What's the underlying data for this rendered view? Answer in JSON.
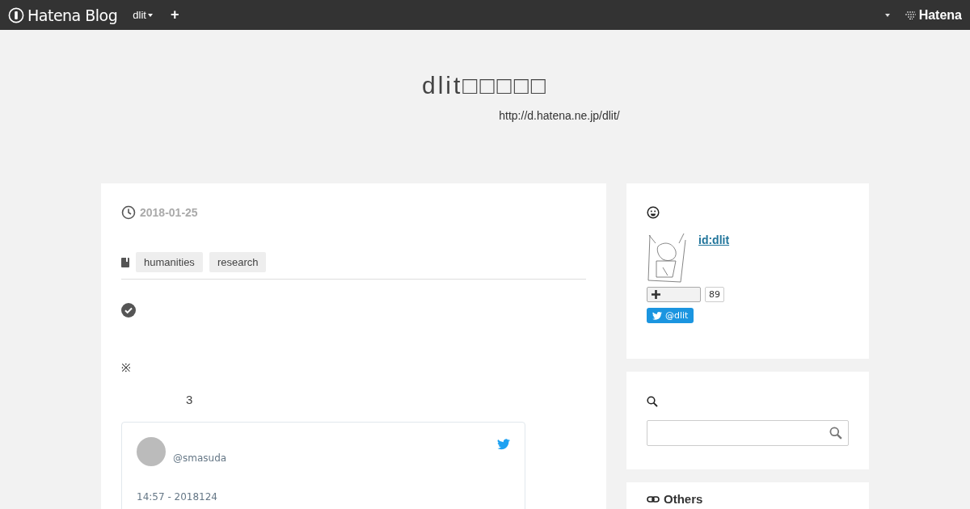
{
  "navbar": {
    "logo": "Hatena Blog",
    "blog_menu": "dlit",
    "add": "+",
    "brand": "Hatena"
  },
  "blog": {
    "title": "dlit□□□□□",
    "url": "http://d.hatena.ne.jp/dlit/"
  },
  "entry": {
    "date": "2018-01-25",
    "categories": [
      "humanities",
      "research"
    ],
    "note_mark": "※",
    "number": "3",
    "tweet": {
      "handle": "@smasuda",
      "time": "14:57 - 2018124"
    }
  },
  "sidebar": {
    "profile": {
      "id": "id:dlit",
      "subscribe_count": "89",
      "twitter": "@dlit"
    },
    "others": {
      "title": "Others"
    }
  }
}
